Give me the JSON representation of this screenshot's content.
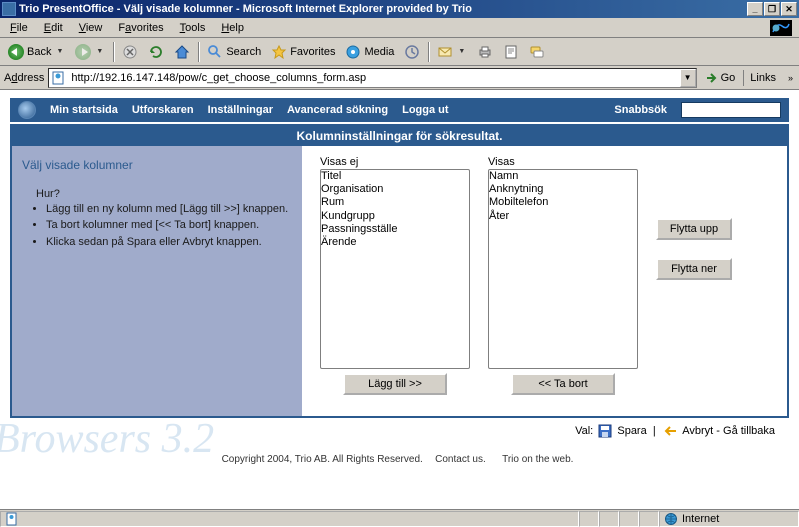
{
  "window": {
    "title": "Trio PresentOffice - Välj visade kolumner   - Microsoft Internet Explorer provided by Trio"
  },
  "menus": {
    "file": "File",
    "edit": "Edit",
    "view": "View",
    "favorites": "Favorites",
    "tools": "Tools",
    "help": "Help"
  },
  "toolbar": {
    "back": "Back",
    "search": "Search",
    "favorites": "Favorites",
    "media": "Media"
  },
  "addressbar": {
    "label": "Address",
    "url": "http://192.16.147.148/pow/c_get_choose_columns_form.asp",
    "go": "Go",
    "links": "Links"
  },
  "appnav": {
    "home": "Min startsida",
    "explorer": "Utforskaren",
    "settings": "Inställningar",
    "advsearch": "Avancerad sökning",
    "logout": "Logga ut",
    "quicksearch_label": "Snabbsök",
    "quicksearch_value": ""
  },
  "panel": {
    "title": "Kolumninställningar för sökresultat.",
    "left_heading": "Välj visade kolumner",
    "how_heading": "Hur?",
    "how_items": [
      "Lägg till en ny kolumn med [Lägg till >>] knappen.",
      "Ta bort kolumner med [<< Ta bort] knappen.",
      "Klicka sedan på Spara eller Avbryt knappen."
    ],
    "hidden_label": "Visas ej",
    "hidden_items": [
      "Titel",
      "Organisation",
      "Rum",
      "Kundgrupp",
      "Passningsställe",
      "Ärende"
    ],
    "shown_label": "Visas",
    "shown_items": [
      "Namn",
      "Anknytning",
      "Mobiltelefon",
      "Åter"
    ],
    "add_btn": "Lägg till >>",
    "remove_btn": "<< Ta bort",
    "move_up": "Flytta upp",
    "move_down": "Flytta ner"
  },
  "actions": {
    "val_label": "Val:",
    "save": "Spara",
    "cancel": "Avbryt - Gå tillbaka"
  },
  "footer": {
    "copyright": "Copyright 2004, Trio AB. All Rights Reserved.",
    "contact": "Contact us.",
    "web": "Trio on the web."
  },
  "status": {
    "zone": "Internet"
  },
  "watermark": "Browsers 3.2"
}
